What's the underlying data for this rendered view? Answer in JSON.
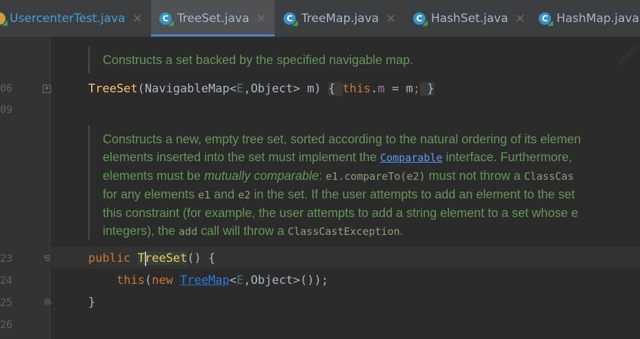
{
  "tabs": [
    {
      "label": "UsercenterTest.java",
      "icon": "junit-class-icon",
      "close": "×",
      "active": false
    },
    {
      "label": "TreeSet.java",
      "icon": "class-icon",
      "close": "×",
      "active": true
    },
    {
      "label": "TreeMap.java",
      "icon": "class-icon",
      "close": "×",
      "active": false
    },
    {
      "label": "HashSet.java",
      "icon": "class-icon",
      "close": "×",
      "active": false
    },
    {
      "label": "HashMap.java",
      "icon": "class-icon",
      "close": "",
      "active": false
    }
  ],
  "tab_icon_letter": "C",
  "gutter": {
    "line_numbers": [
      "06",
      "09",
      "23",
      "24",
      "25",
      "26"
    ]
  },
  "doc1": {
    "text": "Constructs a set backed by the specified navigable map."
  },
  "line106": {
    "ctor": "TreeSet",
    "params": "(NavigableMap<",
    "tparam": "E",
    "params2": ",Object> m) ",
    "open": "{ ",
    "kw_this": "this",
    "dot": ".",
    "field": "m",
    "assign": " = m",
    "semi": ";",
    "close": " }"
  },
  "doc2": {
    "line1": "Constructs a new, empty tree set, sorted according to the natural ordering of its elemen",
    "line2_a": "elements inserted into the set must implement the ",
    "line2_code": "Comparable",
    "line2_b": " interface. Furthermore,",
    "line3_a": "elements must be ",
    "line3_em": "mutually comparable",
    "line3_b": ": ",
    "line3_code": "e1.compareTo(e2)",
    "line3_c": " must not throw a ",
    "line3_code2": "ClassCas",
    "line4_a": "for any elements ",
    "line4_code1": "e1",
    "line4_b": " and ",
    "line4_code2": "e2",
    "line4_c": " in the set. If the user attempts to add an element to the set",
    "line5": "this constraint (for example, the user attempts to add a string element to a set whose e",
    "line6_a": "integers), the ",
    "line6_code": "add",
    "line6_b": " call will throw a ",
    "line6_code2": "ClassCastException",
    "line6_c": "."
  },
  "line123": {
    "kw_public": "public ",
    "ctor": "TreeSet",
    "rest": "() {"
  },
  "line124": {
    "indent": "    ",
    "kw_this": "this",
    "p1": "(",
    "kw_new": "new ",
    "cls": "TreeMap",
    "lt": "<",
    "tparam": "E",
    "rest": ",Object>());"
  },
  "line125": {
    "text": "}"
  },
  "watermark": "zhaoh"
}
